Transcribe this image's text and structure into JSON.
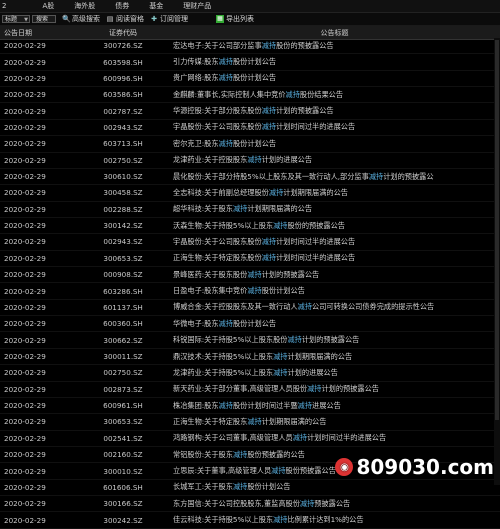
{
  "menu": [
    "2",
    "A股",
    "海外股",
    "债券",
    "基金",
    "理财产品"
  ],
  "toolbar": {
    "select_value": "标题",
    "input_value": "搜索",
    "advanced_search": "高级搜索",
    "read_table": "阅读窗格",
    "subscribe": "订阅管理",
    "export": "导出列表"
  },
  "columns": {
    "date": "公告日期",
    "code": "证券代码",
    "title": "公告标题"
  },
  "rows": [
    {
      "date": "2020-02-29",
      "code": "300726.SZ",
      "pre": "宏达电子:关于公司部分监事",
      "hl": "减持",
      "post": "股份的预披露公告"
    },
    {
      "date": "2020-02-29",
      "code": "603598.SH",
      "pre": "引力传媒:股东",
      "hl": "减持",
      "post": "股份计划公告"
    },
    {
      "date": "2020-02-29",
      "code": "600996.SH",
      "pre": "贵广网络:股东",
      "hl": "减持",
      "post": "股份计划公告"
    },
    {
      "date": "2020-02-29",
      "code": "603586.SH",
      "pre": "金麒麟:董事长,实际控制人集中竞价",
      "hl": "减持",
      "post": "股份结果公告"
    },
    {
      "date": "2020-02-29",
      "code": "002787.SZ",
      "pre": "华源控股:关于部分股东股份",
      "hl": "减持",
      "post": "计划的预披露公告"
    },
    {
      "date": "2020-02-29",
      "code": "002943.SZ",
      "pre": "宇晶股份:关于公司股东股份",
      "hl": "减持",
      "post": "计划时间过半的进展公告"
    },
    {
      "date": "2020-02-29",
      "code": "603713.SH",
      "pre": "密尔克卫:股东",
      "hl": "减持",
      "post": "股份计划公告"
    },
    {
      "date": "2020-02-29",
      "code": "002750.SZ",
      "pre": "龙津药业:关于控股股东",
      "hl": "减持",
      "post": "计划的进展公告"
    },
    {
      "date": "2020-02-29",
      "code": "300610.SZ",
      "pre": "晨化股份:关于部分持股5%以上股东及其一致行动人,部分监事",
      "hl": "减持",
      "post": "计划的预披露公"
    },
    {
      "date": "2020-02-29",
      "code": "300458.SZ",
      "pre": "全志科技:关于前副总经理股份",
      "hl": "减持",
      "post": "计划期限届满的公告"
    },
    {
      "date": "2020-02-29",
      "code": "002288.SZ",
      "pre": "超华科技:关于股东",
      "hl": "减持",
      "post": "计划期限届满的公告"
    },
    {
      "date": "2020-02-29",
      "code": "300142.SZ",
      "pre": "沃森生物:关于持股5%以上股东",
      "hl": "减持",
      "post": "股份的预披露公告"
    },
    {
      "date": "2020-02-29",
      "code": "002943.SZ",
      "pre": "宇晶股份:关于公司股东股份",
      "hl": "减持",
      "post": "计划时间过半的进展公告"
    },
    {
      "date": "2020-02-29",
      "code": "300653.SZ",
      "pre": "正海生物:关于特定股东股份",
      "hl": "减持",
      "post": "计划时间过半的进展公告"
    },
    {
      "date": "2020-02-29",
      "code": "000908.SZ",
      "pre": "景峰医药:关于股东股份",
      "hl": "减持",
      "post": "计划的预披露公告"
    },
    {
      "date": "2020-02-29",
      "code": "603286.SH",
      "pre": "日盈电子:股东集中竞价",
      "hl": "减持",
      "post": "股份计划公告"
    },
    {
      "date": "2020-02-29",
      "code": "601137.SH",
      "pre": "博威合金:关于控股股东及其一致行动人",
      "hl": "减持",
      "post": "公司可转换公司债券完成的提示性公告"
    },
    {
      "date": "2020-02-29",
      "code": "600360.SH",
      "pre": "华微电子:股东",
      "hl": "减持",
      "post": "股份计划公告"
    },
    {
      "date": "2020-02-29",
      "code": "300662.SZ",
      "pre": "科锐国际:关于持股5%以上股东股份",
      "hl": "减持",
      "post": "计划的预披露公告"
    },
    {
      "date": "2020-02-29",
      "code": "300011.SZ",
      "pre": "鼎汉技术:关于持股5%以上股东",
      "hl": "减持",
      "post": "计划期限届满的公告"
    },
    {
      "date": "2020-02-29",
      "code": "002750.SZ",
      "pre": "龙津药业:关于持股5%以上股东",
      "hl": "减持",
      "post": "计划的进展公告"
    },
    {
      "date": "2020-02-29",
      "code": "002873.SZ",
      "pre": "新天药业:关于部分董事,高级管理人员股份",
      "hl": "减持",
      "post": "计划的预披露公告"
    },
    {
      "date": "2020-02-29",
      "code": "600961.SH",
      "pre": "株冶集团:股东",
      "hl": "减持",
      "post": "股份计划时间过半暨",
      "hl2": "减持",
      "post2": "进展公告"
    },
    {
      "date": "2020-02-29",
      "code": "300653.SZ",
      "pre": "正海生物:关于特定股东",
      "hl": "减持",
      "post": "计划期限届满的公告"
    },
    {
      "date": "2020-02-29",
      "code": "002541.SZ",
      "pre": "鸿路钢构:关于公司董事,高级管理人员",
      "hl": "减持",
      "post": "计划时间过半的进展公告"
    },
    {
      "date": "2020-02-29",
      "code": "002160.SZ",
      "pre": "常铝股份:关于股东",
      "hl": "减持",
      "post": "股份预披露的公告"
    },
    {
      "date": "2020-02-29",
      "code": "300010.SZ",
      "pre": "立思辰:关于董事,高级管理人员",
      "hl": "减持",
      "post": "股份预披露公告"
    },
    {
      "date": "2020-02-29",
      "code": "601606.SH",
      "pre": "长城军工:关于股东",
      "hl": "减持",
      "post": "股份计划公告"
    },
    {
      "date": "2020-02-29",
      "code": "300166.SZ",
      "pre": "东方国信:关于公司控股股东,董监高股份",
      "hl": "减持",
      "post": "预披露公告"
    },
    {
      "date": "2020-02-29",
      "code": "300242.SZ",
      "pre": "佳云科技:关于持股5%以上股东",
      "hl": "减持",
      "post": "比例累计达到1%的公告"
    }
  ],
  "watermark": "809030.com"
}
